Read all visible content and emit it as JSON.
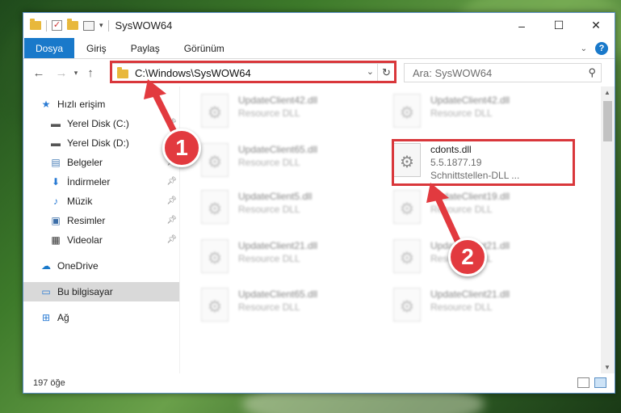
{
  "window": {
    "title": "SysWOW64",
    "controls": {
      "minimize": "–",
      "maximize": "☐",
      "close": "✕"
    }
  },
  "ribbon": {
    "tabs": [
      "Dosya",
      "Giriş",
      "Paylaş",
      "Görünüm"
    ]
  },
  "navigation": {
    "address_path": "C:\\Windows\\SysWOW64",
    "search_placeholder": "Ara: SysWOW64"
  },
  "sidebar": {
    "items": [
      {
        "label": "Hızlı erişim",
        "icon": "star-icon"
      },
      {
        "label": "Yerel Disk (C:)",
        "icon": "drive-icon",
        "pinned": true
      },
      {
        "label": "Yerel Disk (D:)",
        "icon": "drive-icon",
        "pinned": true
      },
      {
        "label": "Belgeler",
        "icon": "documents-icon",
        "pinned": true
      },
      {
        "label": "İndirmeler",
        "icon": "download-icon",
        "pinned": true
      },
      {
        "label": "Müzik",
        "icon": "music-icon",
        "pinned": true
      },
      {
        "label": "Resimler",
        "icon": "pictures-icon",
        "pinned": true
      },
      {
        "label": "Videolar",
        "icon": "videos-icon",
        "pinned": true
      },
      {
        "label": "OneDrive",
        "icon": "cloud-icon"
      },
      {
        "label": "Bu bilgisayar",
        "icon": "computer-icon",
        "selected": true
      },
      {
        "label": "Ağ",
        "icon": "network-icon"
      }
    ]
  },
  "files": [
    {
      "name": "UpdateClient42.dll",
      "type": "Resource DLL"
    },
    {
      "name": "UpdateClient42.dll",
      "type": "Resource DLL"
    },
    {
      "name": "UpdateClient65.dll",
      "type": "Resource DLL"
    },
    {
      "name": "cdonts.dll",
      "version": "5.5.1877.19",
      "type": "Schnittstellen-DLL ...",
      "highlighted": true
    },
    {
      "name": "UpdateClient5.dll",
      "type": "Resource DLL"
    },
    {
      "name": "UpdateClient19.dll",
      "type": "Resource DLL"
    },
    {
      "name": "UpdateClient21.dll",
      "type": "Resource DLL"
    },
    {
      "name": "UpdateClient21.dll",
      "type": "Resource DLL"
    },
    {
      "name": "UpdateClient65.dll",
      "type": "Resource DLL"
    },
    {
      "name": "UpdateClient21.dll",
      "type": "Resource DLL"
    }
  ],
  "status": {
    "count": "197 öğe"
  },
  "annotations": {
    "step1": "1",
    "step2": "2",
    "color": "#e23a3f"
  }
}
